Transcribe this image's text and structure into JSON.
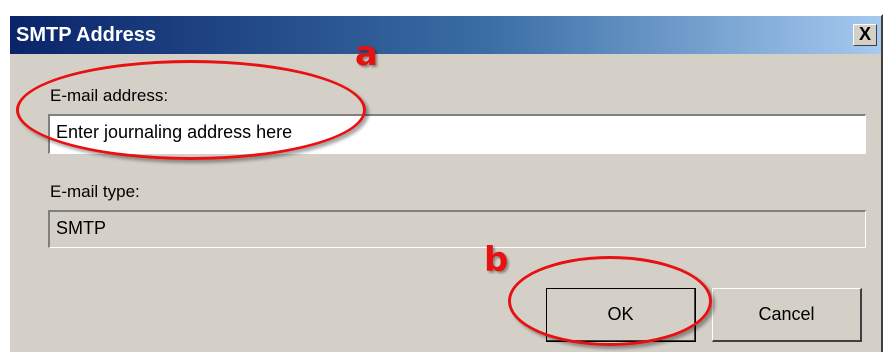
{
  "dialog": {
    "title": "SMTP Address",
    "close_label": "X",
    "email_label": "E-mail address:",
    "email_value": "Enter journaling address here",
    "type_label": "E-mail type:",
    "type_value": "SMTP",
    "ok_label": "OK",
    "cancel_label": "Cancel"
  },
  "annotations": {
    "a": "a",
    "b": "b",
    "color": "#e81010"
  }
}
